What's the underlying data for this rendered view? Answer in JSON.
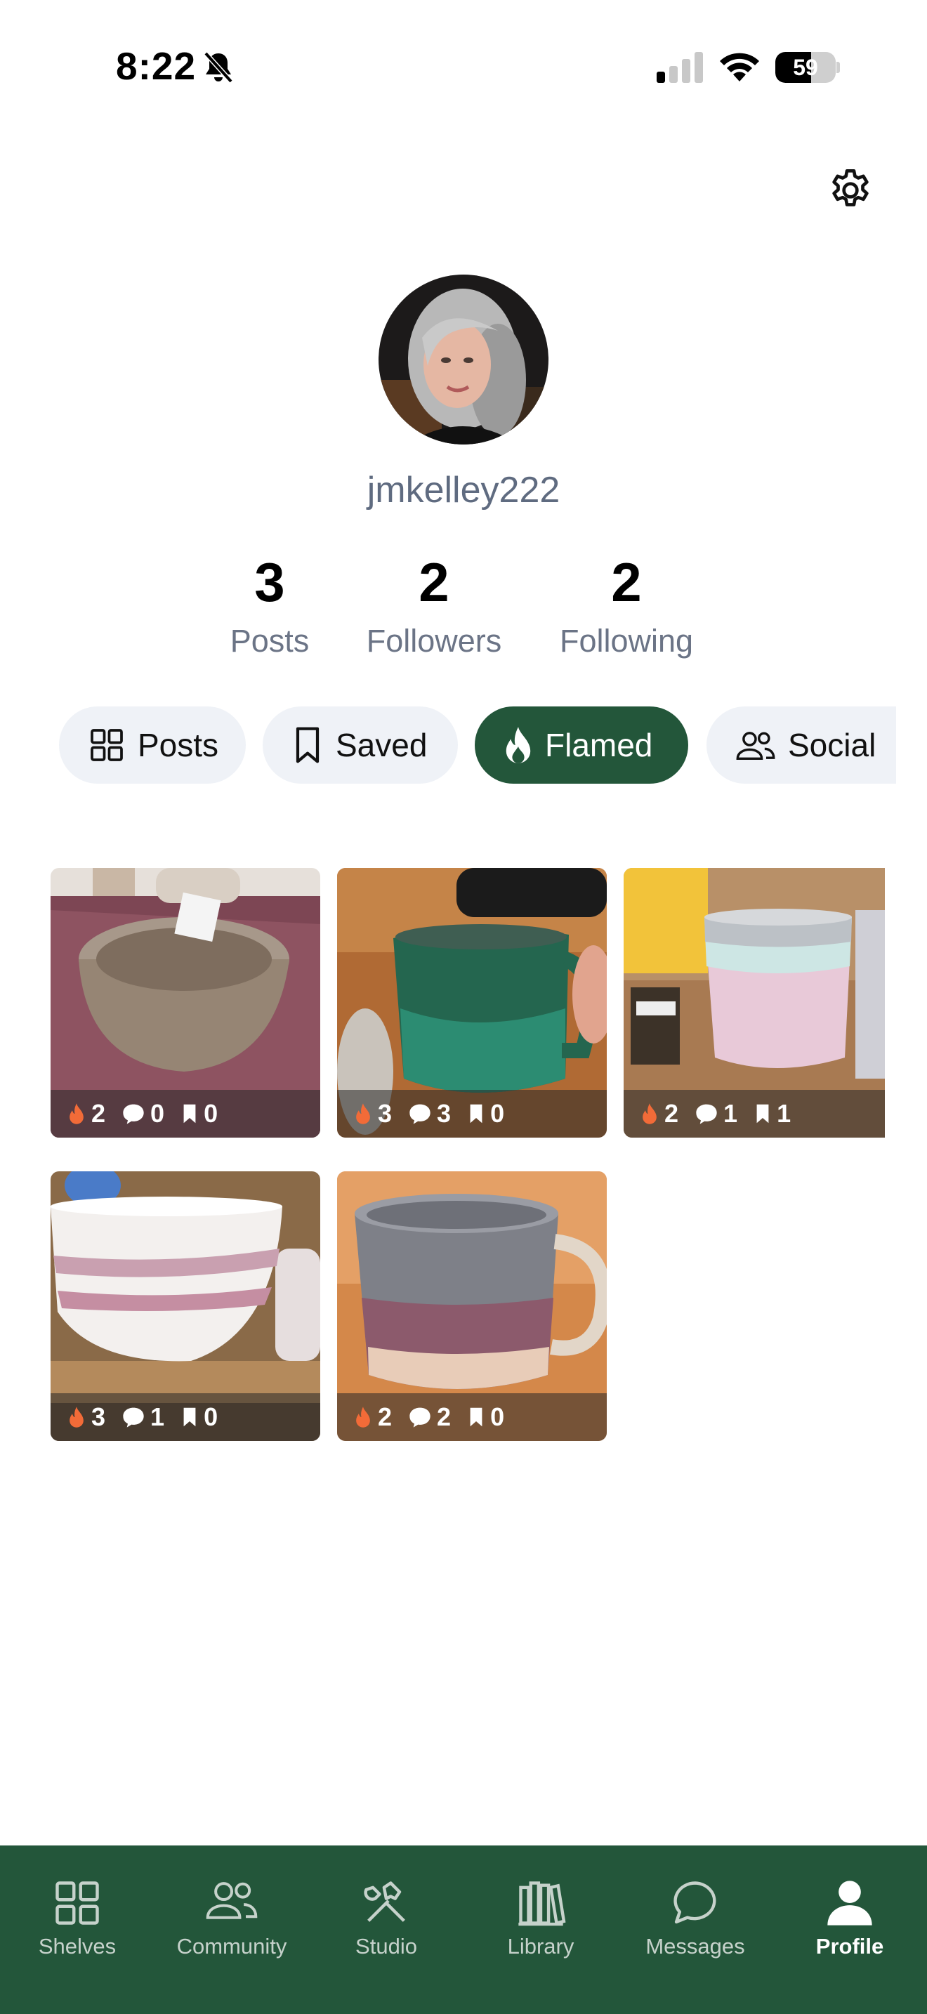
{
  "status_bar": {
    "time": "8:22",
    "battery": "59",
    "battery_level": 0.59
  },
  "profile": {
    "username": "jmkelley222",
    "stats": [
      {
        "value": "3",
        "label": "Posts"
      },
      {
        "value": "2",
        "label": "Followers"
      },
      {
        "value": "2",
        "label": "Following"
      }
    ]
  },
  "filter_tabs": [
    {
      "label": "Posts",
      "icon": "grid-icon",
      "active": false
    },
    {
      "label": "Saved",
      "icon": "bookmark-icon",
      "active": false
    },
    {
      "label": "Flamed",
      "icon": "flame-icon",
      "active": true
    },
    {
      "label": "Social",
      "icon": "people-icon",
      "active": false
    }
  ],
  "posts": [
    {
      "flames": "2",
      "comments": "0",
      "saves": "0"
    },
    {
      "flames": "3",
      "comments": "3",
      "saves": "0"
    },
    {
      "flames": "2",
      "comments": "1",
      "saves": "1"
    },
    {
      "flames": "3",
      "comments": "1",
      "saves": "0"
    },
    {
      "flames": "2",
      "comments": "2",
      "saves": "0"
    }
  ],
  "bottom_nav": [
    {
      "label": "Shelves",
      "icon": "grid-icon",
      "active": false
    },
    {
      "label": "Community",
      "icon": "people-icon",
      "active": false
    },
    {
      "label": "Studio",
      "icon": "tools-icon",
      "active": false
    },
    {
      "label": "Library",
      "icon": "books-icon",
      "active": false
    },
    {
      "label": "Messages",
      "icon": "chat-icon",
      "active": false
    },
    {
      "label": "Profile",
      "icon": "person-icon",
      "active": true
    }
  ],
  "colors": {
    "brand_green": "#23563a",
    "chip_bg": "#eff2f7",
    "flame": "#f26b38"
  }
}
